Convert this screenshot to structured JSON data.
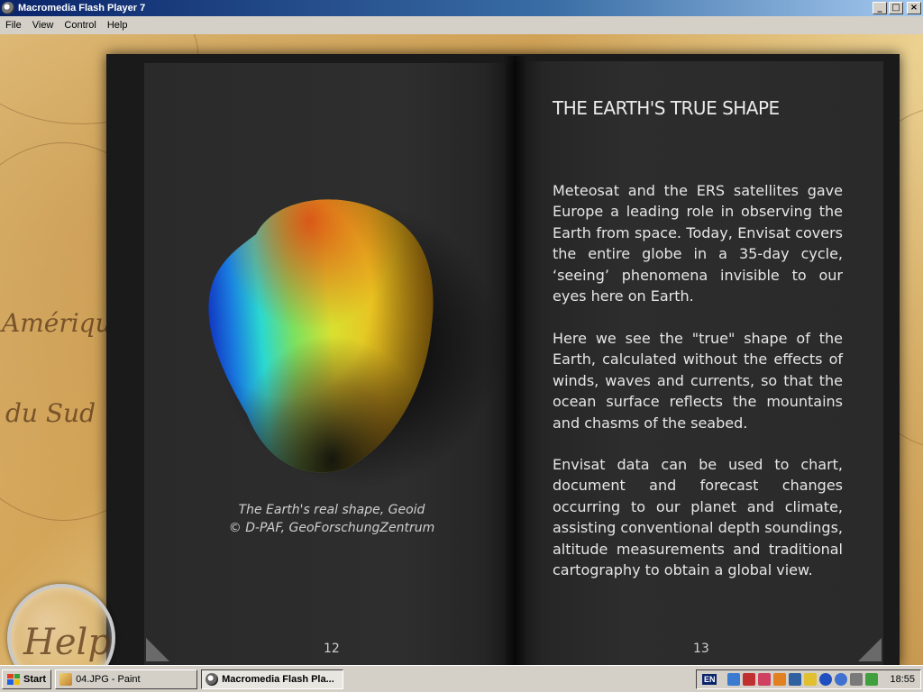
{
  "window": {
    "title": "Macromedia Flash Player 7",
    "controls": {
      "minimize": "_",
      "maximize": "□",
      "close": "×"
    }
  },
  "menu": [
    "File",
    "View",
    "Control",
    "Help"
  ],
  "background_map": {
    "labels": [
      "Amérique",
      "du Sud"
    ],
    "magnifier_label": "Help"
  },
  "book": {
    "left_page": {
      "caption_line1": "The Earth's real shape, Geoid",
      "caption_line2": "© D-PAF, GeoForschungZentrum",
      "page_number": "12"
    },
    "right_page": {
      "heading": "THE EARTH'S TRUE SHAPE",
      "paragraphs": [
        "Meteosat and the ERS satellites gave Europe a leading role in observing the Earth from space.  Today, Envisat covers the entire globe in a 35-day cycle, ‘seeing’ phenomena invisible to our eyes here on Earth.",
        "Here we see the \"true\" shape of the Earth, calculated without the effects of winds, waves and currents, so that the ocean surface reflects the mountains and chasms of the seabed.",
        "Envisat data can be used to chart, document and forecast changes occurring to our planet and climate, assisting conventional depth soundings, altitude measurements and traditional cartography to obtain a global view."
      ],
      "page_number": "13"
    }
  },
  "taskbar": {
    "start": "Start",
    "tasks": [
      {
        "label": "04.JPG - Paint",
        "icon": "paint-icon",
        "active": false
      },
      {
        "label": "Macromedia Flash Pla...",
        "icon": "flash-icon",
        "active": true
      }
    ],
    "tray": {
      "language": "EN",
      "clock": "18:55"
    }
  },
  "colors": {
    "titlebar": "#0a246a",
    "page": "#2b2b2b",
    "text": "#e6e6e6"
  }
}
